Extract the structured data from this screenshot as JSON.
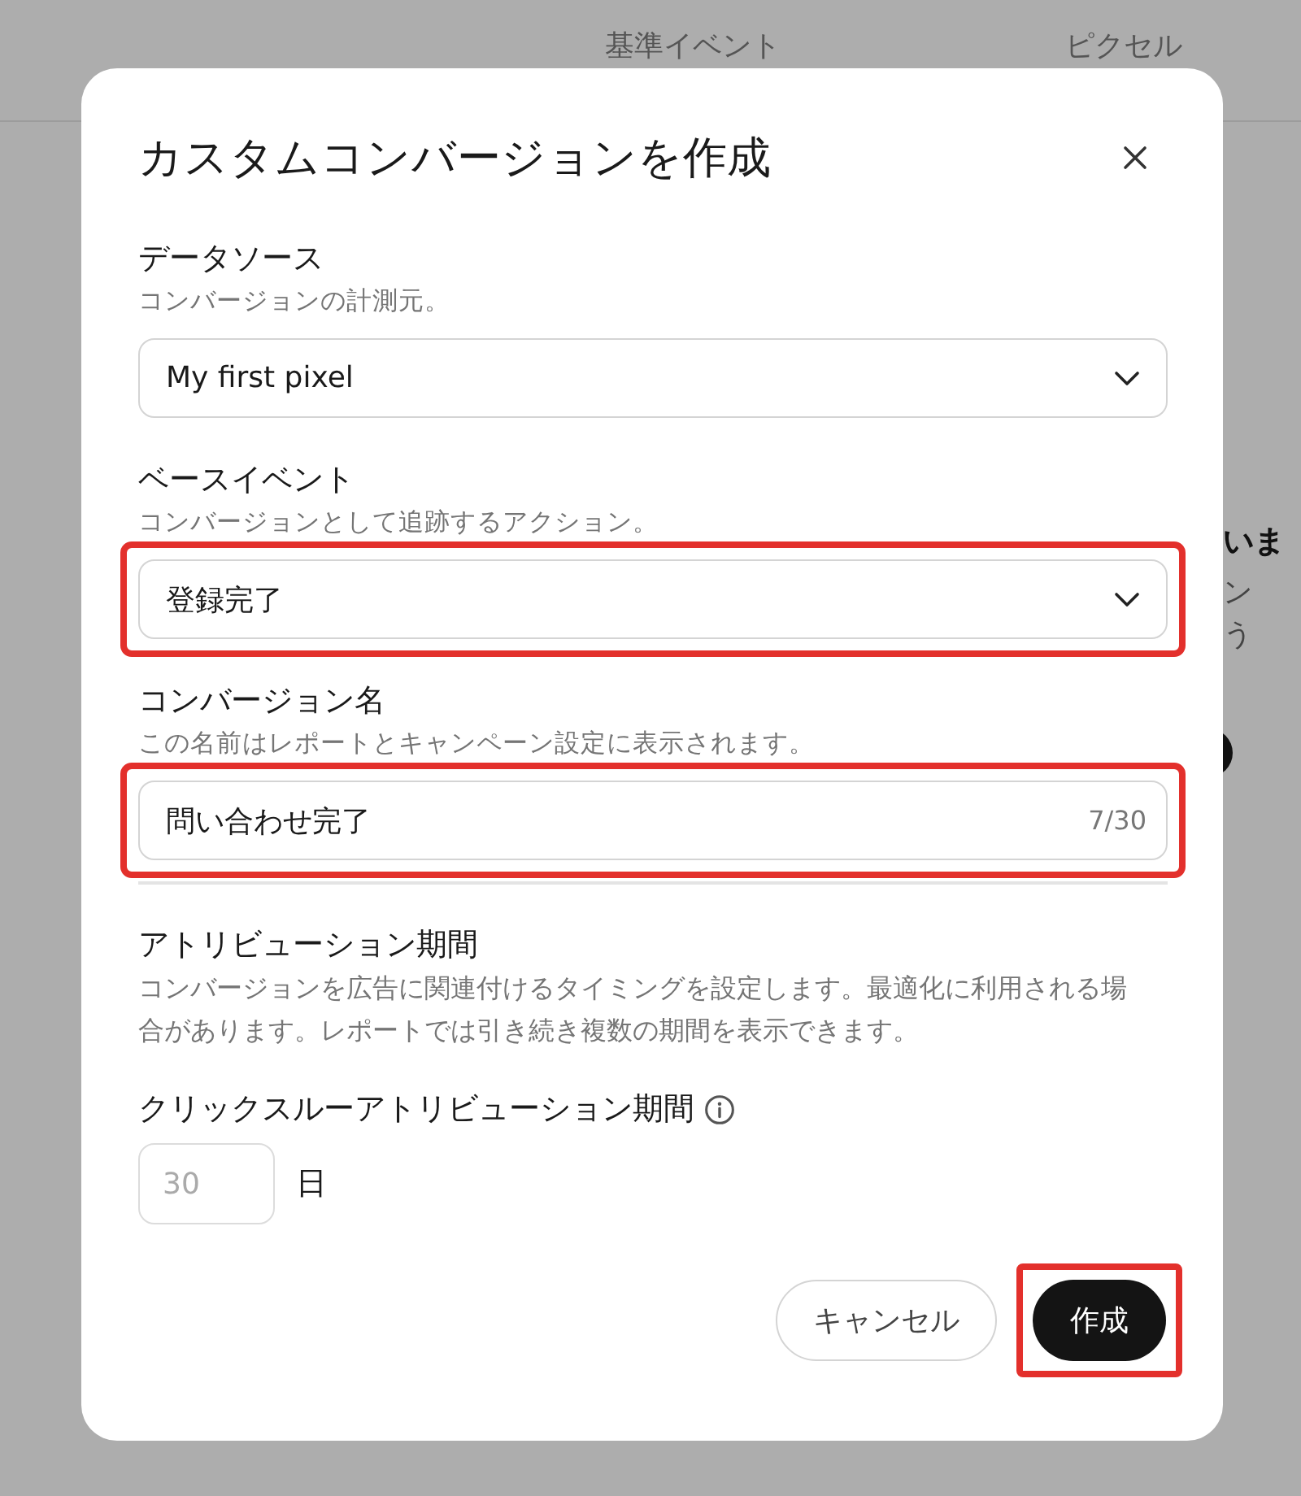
{
  "background": {
    "tabs": [
      {
        "label": "基準イベント"
      },
      {
        "label": "ピクセル"
      }
    ],
    "fragments": [
      {
        "text": "いま",
        "kind": "heading"
      },
      {
        "text": "ン",
        "kind": "body"
      },
      {
        "text": "う",
        "kind": "body"
      }
    ]
  },
  "dialog": {
    "title": "カスタムコンバージョンを作成",
    "fields": [
      {
        "kind": "select",
        "label": "データソース",
        "description": "コンバージョンの計測元。",
        "value": "My first pixel",
        "highlighted": false
      },
      {
        "kind": "select",
        "label": "ベースイベント",
        "description": "コンバージョンとして追跡するアクション。",
        "value": "登録完了",
        "highlighted": true
      },
      {
        "kind": "text",
        "label": "コンバージョン名",
        "description": "この名前はレポートとキャンペーン設定に表示されます。",
        "value": "問い合わせ完了",
        "counter": "7/30",
        "highlighted": true
      }
    ],
    "attribution": {
      "label": "アトリビューション期間",
      "description": "コンバージョンを広告に関連付けるタイミングを設定します。最適化に利用される場合があります。レポートでは引き続き複数の期間を表示できます。",
      "click_label": "クリックスルーアトリビューション期間",
      "days_placeholder": "30",
      "unit": "日"
    },
    "buttons": [
      {
        "label": "キャンセル",
        "kind": "secondary",
        "highlighted": false
      },
      {
        "label": "作成",
        "kind": "primary",
        "highlighted": true
      }
    ]
  }
}
